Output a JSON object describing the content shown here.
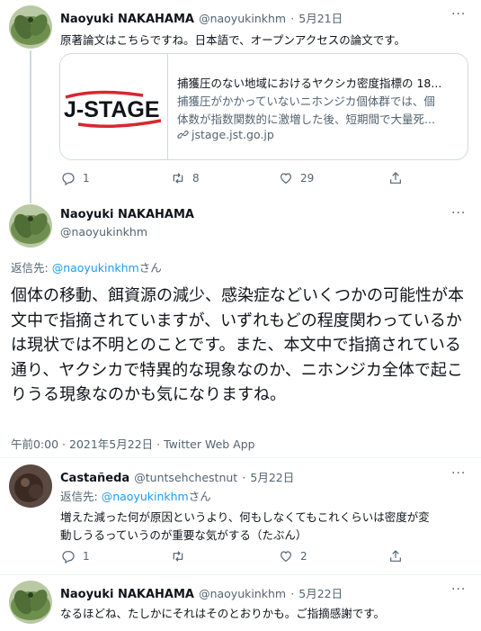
{
  "tweet1": {
    "name": "Naoyuki NAKAHAMA",
    "handle": "@naoyukinkhm",
    "date": "5月21日",
    "text": "原著論文はこちらですね。日本語で、オープンアクセスの論文です。",
    "card": {
      "logo_text": "J-STAGE",
      "title": "捕獲圧のない地域におけるヤクシカ密度指標の 18...",
      "desc1": "捕獲圧がかかっていないニホンジカ個体群では、個",
      "desc2": "体数が指数関数的に激増した後、短期間で大量死...",
      "domain": "jstage.jst.go.jp"
    },
    "reply_count": "1",
    "retweet_count": "8",
    "like_count": "29"
  },
  "tweet2": {
    "name": "Naoyuki NAKAHAMA",
    "handle": "@naoyukinkhm",
    "reply_to_label": "返信先: ",
    "reply_to_handle": "@naoyukinkhm",
    "reply_to_suffix": "さん",
    "text": "個体の移動、餌資源の減少、感染症などいくつかの可能性が本文中で指摘されていますが、いずれもどの程度関わっているかは現状では不明とのことです。また、本文中で指摘されている通り、ヤクシカで特異的な現象なのか、ニホンジカ全体で起こりうる現象なのかも気になりますね。",
    "meta": "午前0:00 · 2021年5月22日 · Twitter Web App"
  },
  "tweet3": {
    "name": "Castañeda",
    "handle": "@tuntsehchestnut",
    "date": "5月22日",
    "reply_to_label": "返信先: ",
    "reply_to_handle": "@naoyukinkhm",
    "reply_to_suffix": "さん",
    "text_line1": "増えた減った何が原因というより、何もしなくてもこれくらいは密度が変",
    "text_line2": "動しうるっていうのが重要な気がする（たぶん）",
    "reply_count": "1",
    "like_count": "2"
  },
  "tweet4": {
    "name": "Naoyuki NAKAHAMA",
    "handle": "@naoyukinkhm",
    "date": "5月22日",
    "text": "なるほどね、たしかにそれはそのとおりかも。ご指摘感謝です。"
  },
  "separator": "·",
  "more_glyph": "···",
  "colors": {
    "text": "#0f1419",
    "muted": "#536471",
    "link": "#1d9bf0",
    "border": "#cfd9de",
    "jstage_red": "#d7282f"
  }
}
